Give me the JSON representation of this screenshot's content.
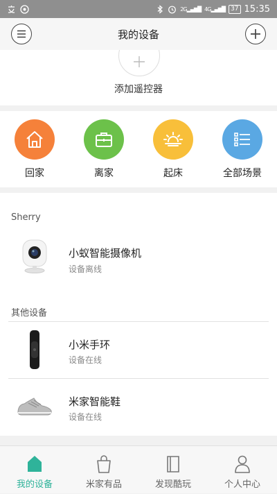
{
  "status_bar": {
    "time": "15:35",
    "battery": "37",
    "network_label_1": "2G",
    "network_label_2": "4G"
  },
  "header": {
    "title": "我的设备"
  },
  "add_remote": {
    "label": "添加遥控器"
  },
  "scenes": [
    {
      "label": "回家",
      "color": "#f5813a",
      "icon": "home-icon"
    },
    {
      "label": "离家",
      "color": "#6cc14a",
      "icon": "briefcase-icon"
    },
    {
      "label": "起床",
      "color": "#f8bf3a",
      "icon": "sunrise-icon"
    },
    {
      "label": "全部场景",
      "color": "#5aa8e3",
      "icon": "list-icon"
    }
  ],
  "device_groups": [
    {
      "label": "Sherry",
      "devices": [
        {
          "name": "小蚁智能摄像机",
          "status": "设备离线",
          "icon": "camera-icon"
        }
      ]
    },
    {
      "label": "其他设备",
      "devices": [
        {
          "name": "小米手环",
          "status": "设备在线",
          "icon": "band-icon"
        },
        {
          "name": "米家智能鞋",
          "status": "设备在线",
          "icon": "shoe-icon"
        }
      ]
    }
  ],
  "bottom_nav": [
    {
      "label": "我的设备",
      "icon": "home-filled-icon",
      "active": true
    },
    {
      "label": "米家有品",
      "icon": "shopping-bag-icon",
      "active": false
    },
    {
      "label": "发现酷玩",
      "icon": "book-icon",
      "active": false
    },
    {
      "label": "个人中心",
      "icon": "person-icon",
      "active": false
    }
  ],
  "colors": {
    "accent": "#2fb39a",
    "status_bar": "#8f8f8f"
  }
}
